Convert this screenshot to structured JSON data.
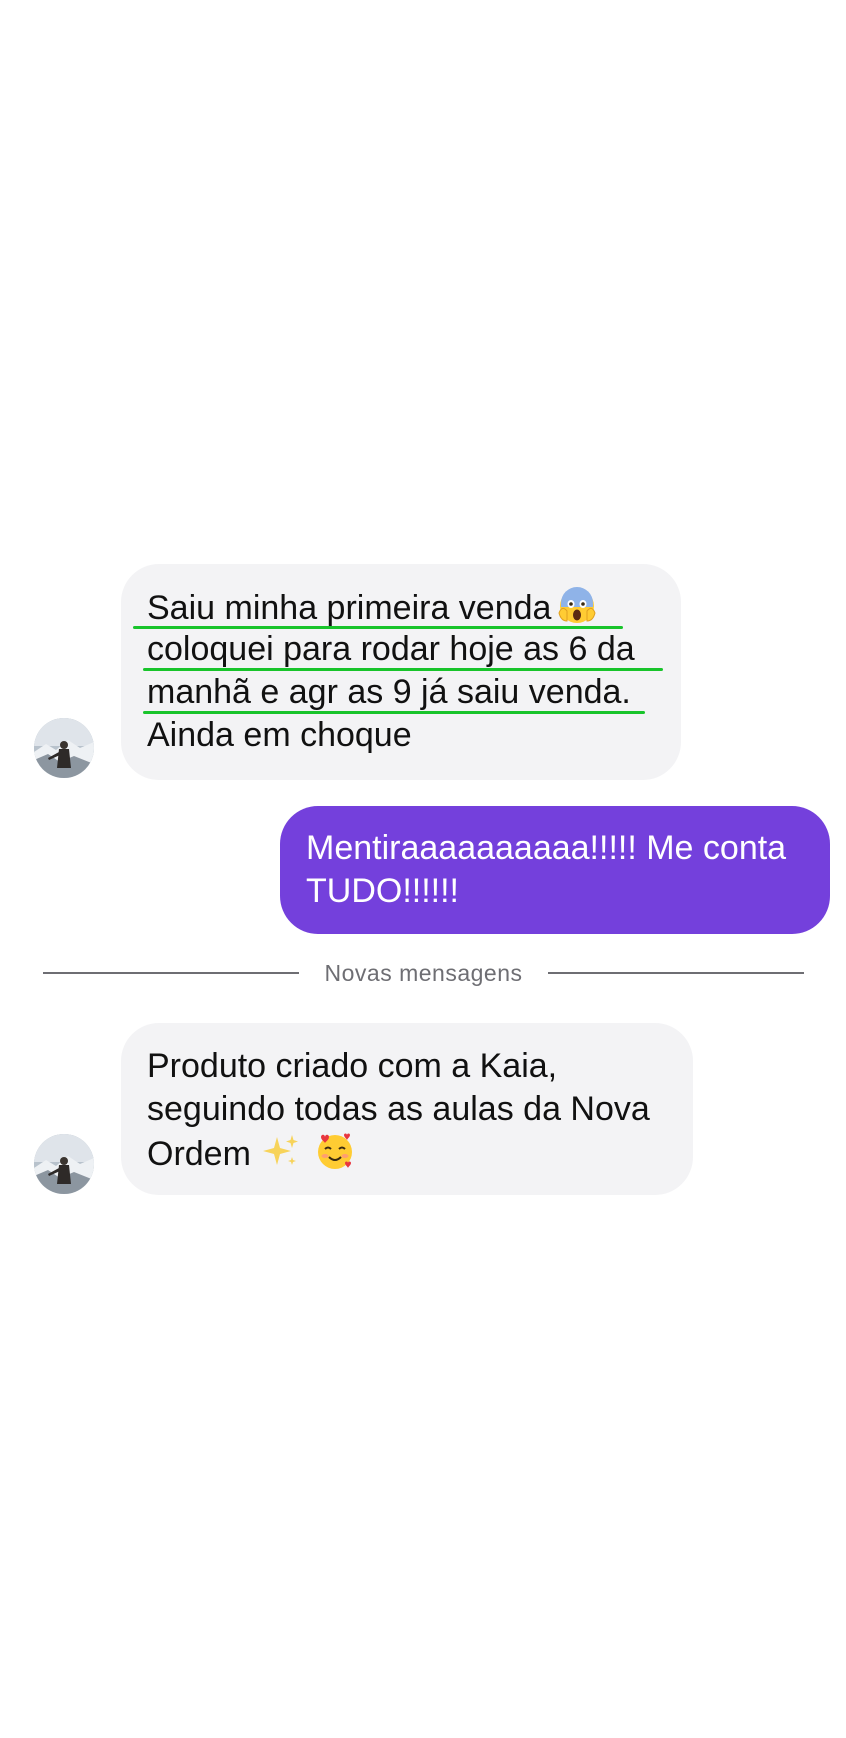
{
  "conversation": {
    "messages": [
      {
        "direction": "incoming",
        "lines": [
          "Saiu minha primeira venda",
          "coloquei para rodar hoje as 6 da",
          "manhã e agr as 9 já saiu venda.",
          "Ainda em choque"
        ],
        "emoji": "face-screaming-in-fear-icon",
        "highlight_color": "#18c42b"
      },
      {
        "direction": "outgoing",
        "lines": [
          "Mentiraaaaaaaaaa!!!!! Me conta",
          "TUDO!!!!!!"
        ]
      },
      {
        "direction": "incoming",
        "lines": [
          "Produto criado com a Kaia,",
          "seguindo todas as aulas da Nova",
          "Ordem"
        ],
        "emojis": [
          "sparkles-icon",
          "smiling-face-with-hearts-icon"
        ]
      }
    ],
    "divider_label": "Novas mensagens"
  },
  "colors": {
    "incoming_bubble": "#f3f3f5",
    "outgoing_bubble": "#7440dc",
    "divider": "#6e6e73",
    "background": "#ffffff"
  }
}
